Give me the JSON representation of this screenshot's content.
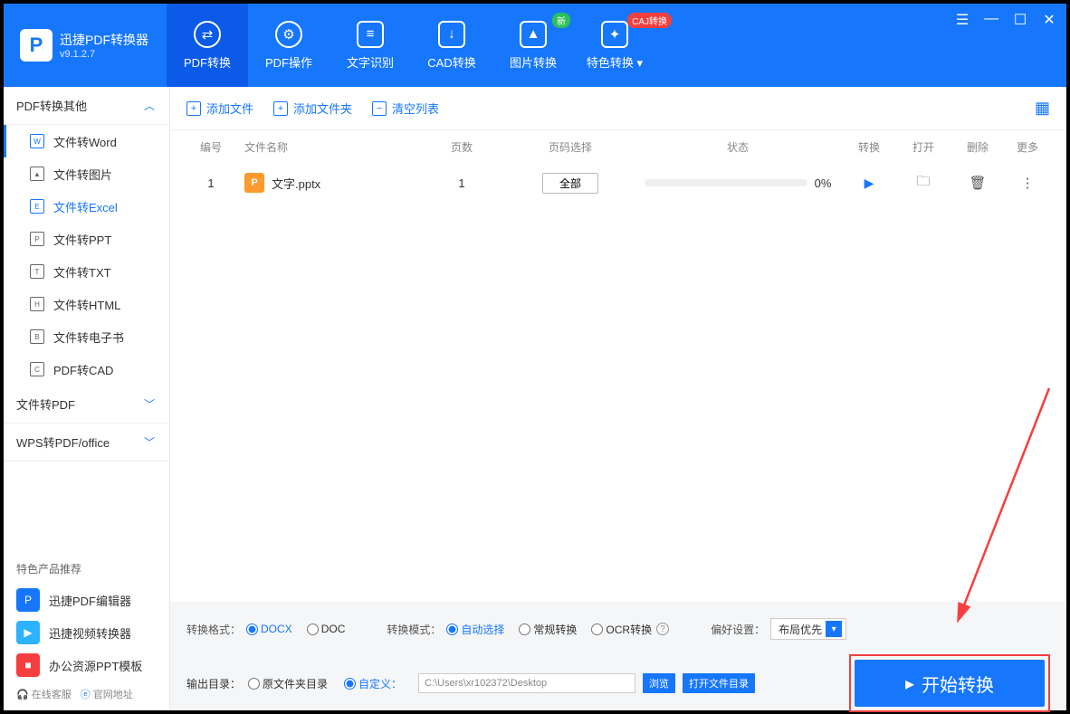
{
  "app": {
    "name": "迅捷PDF转换器",
    "version": "v9.1.2.7"
  },
  "window_controls": {
    "menu": "☰",
    "min": "—",
    "max": "☐",
    "close": "✕"
  },
  "tabs": [
    {
      "label": "PDF转换",
      "active": true,
      "icon": "⇄"
    },
    {
      "label": "PDF操作",
      "icon": "⚙"
    },
    {
      "label": "文字识别",
      "icon": "≡"
    },
    {
      "label": "CAD转换",
      "icon": "↓"
    },
    {
      "label": "图片转换",
      "icon": "▲",
      "badge": "新",
      "badge_color": "green"
    },
    {
      "label": "特色转换",
      "icon": "✦",
      "dropdown": true,
      "badge": "CAJ转换",
      "badge_color": "red"
    }
  ],
  "sidebar": {
    "groups": [
      {
        "label": "PDF转换其他",
        "expanded": true,
        "items": [
          {
            "label": "文件转Word",
            "ico": "W",
            "active_bar": true
          },
          {
            "label": "文件转图片",
            "ico": "▲"
          },
          {
            "label": "文件转Excel",
            "ico": "E",
            "selected": true
          },
          {
            "label": "文件转PPT",
            "ico": "P"
          },
          {
            "label": "文件转TXT",
            "ico": "T"
          },
          {
            "label": "文件转HTML",
            "ico": "H"
          },
          {
            "label": "文件转电子书",
            "ico": "B"
          },
          {
            "label": "PDF转CAD",
            "ico": "C"
          }
        ]
      },
      {
        "label": "文件转PDF",
        "expanded": false
      },
      {
        "label": "WPS转PDF/office",
        "expanded": false
      }
    ],
    "promo_title": "特色产品推荐",
    "promo": [
      {
        "label": "迅捷PDF编辑器",
        "color": "#1677FD"
      },
      {
        "label": "迅捷视频转换器",
        "color": "#2BB3FF"
      },
      {
        "label": "办公资源PPT模板",
        "color": "#F53F3F"
      }
    ],
    "footer": {
      "service": "在线客服",
      "site": "官网地址"
    }
  },
  "toolbar": {
    "add_file": "添加文件",
    "add_folder": "添加文件夹",
    "clear_list": "清空列表"
  },
  "table": {
    "headers": {
      "num": "编号",
      "name": "文件名称",
      "pages": "页数",
      "range": "页码选择",
      "status": "状态",
      "conv": "转换",
      "open": "打开",
      "del": "删除",
      "more": "更多"
    },
    "rows": [
      {
        "num": "1",
        "ico": "P",
        "name": "文字.pptx",
        "pages": "1",
        "range": "全部",
        "status": "0%"
      }
    ]
  },
  "options": {
    "format_label": "转换格式：",
    "formats": [
      {
        "label": "DOCX",
        "checked": true
      },
      {
        "label": "DOC"
      }
    ],
    "mode_label": "转换模式：",
    "modes": [
      {
        "label": "自动选择",
        "checked": true
      },
      {
        "label": "常规转换"
      },
      {
        "label": "OCR转换"
      }
    ],
    "pref_label": "偏好设置：",
    "pref_value": "布局优先"
  },
  "output": {
    "label": "输出目录：",
    "orig": "原文件夹目录",
    "custom": "自定义：",
    "path": "C:\\Users\\xr102372\\Desktop",
    "browse": "浏览",
    "open_dir": "打开文件目录"
  },
  "start_button": "开始转换"
}
